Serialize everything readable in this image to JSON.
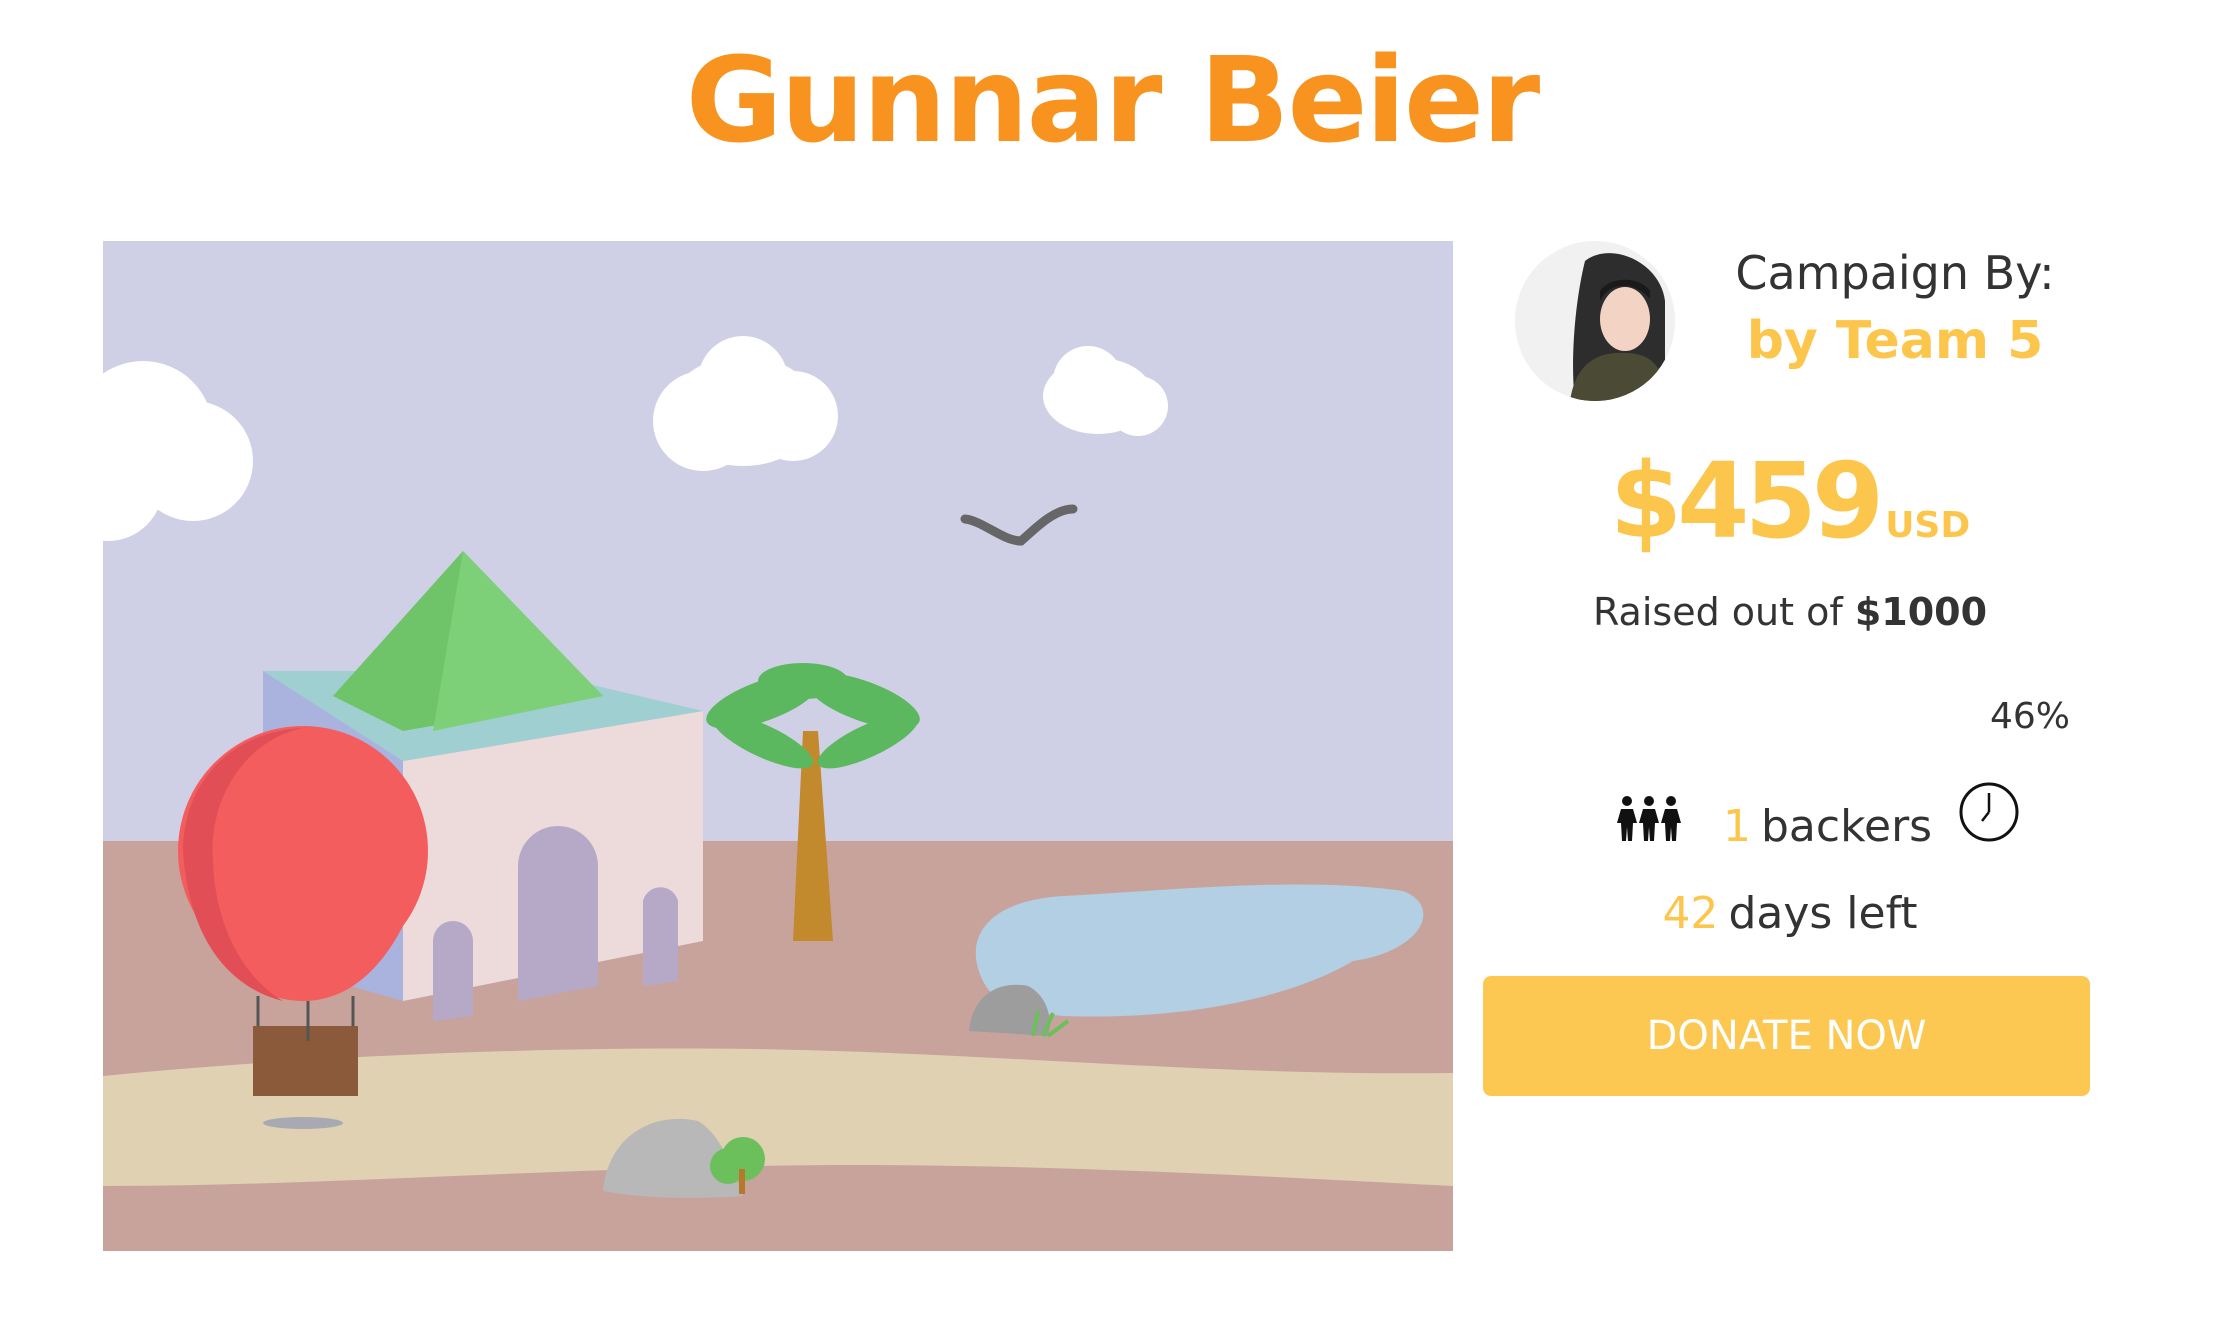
{
  "page": {
    "title": "Gunnar Beier"
  },
  "campaign": {
    "by_label": "Campaign By:",
    "by_name": "by Team 5",
    "amount": "$459",
    "currency": "USD",
    "raised_prefix": "Raised out of",
    "goal": "$1000",
    "progress_percent": "46%",
    "progress_value": 0.46,
    "backers_count": "1",
    "backers_label": "backers",
    "days_count": "42",
    "days_label": "days left",
    "donate_label": "DONATE NOW"
  },
  "icons": {
    "backers": "people-group-icon",
    "time": "clock-icon"
  },
  "colors": {
    "title": "#f7931e",
    "accent": "#fcc64d",
    "button": "#fcc852",
    "text": "#333333"
  }
}
